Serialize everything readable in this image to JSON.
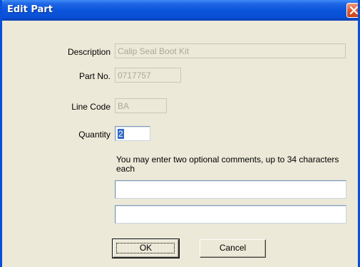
{
  "window": {
    "title": "Edit Part"
  },
  "form": {
    "description": {
      "label": "Description",
      "value": "Calip Seal Boot Kit"
    },
    "part_no": {
      "label": "Part No.",
      "value": "0717757"
    },
    "line_code": {
      "label": "Line Code",
      "value": "BA"
    },
    "quantity": {
      "label": "Quantity",
      "value": "2"
    },
    "comments_note": "You may enter two optional comments, up to 34 characters each",
    "comment1": "",
    "comment2": ""
  },
  "buttons": {
    "ok": "OK",
    "cancel": "Cancel"
  },
  "icons": {
    "close": "close-icon"
  },
  "colors": {
    "titlebar": "#0a55db",
    "close_button": "#e2582f",
    "dialog_background": "#ece9d8",
    "selection": "#316ac5"
  }
}
